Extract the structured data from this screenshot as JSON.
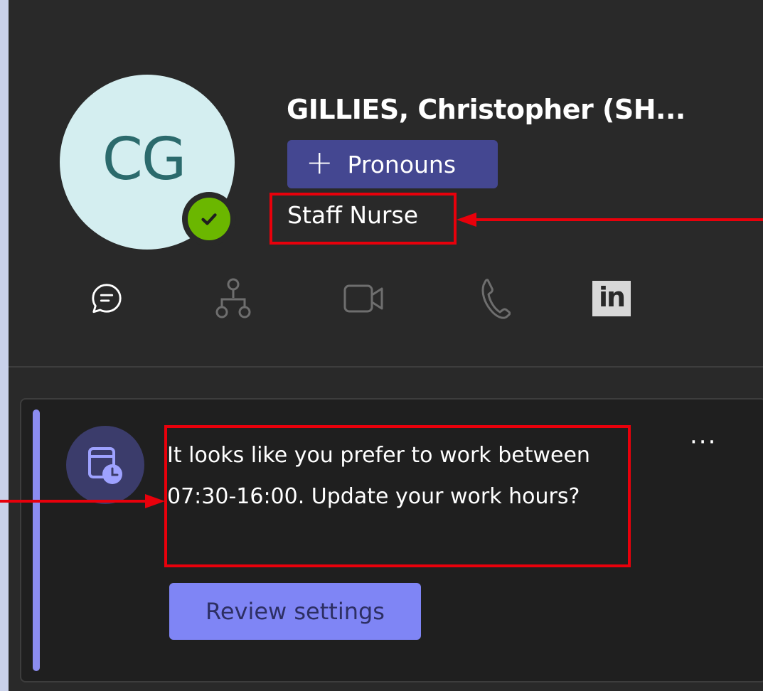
{
  "profile": {
    "initials": "CG",
    "name": "GILLIES, Christopher (SH...",
    "pronouns_label": "Pronouns",
    "job_title": "Staff Nurse",
    "presence": "available"
  },
  "actions": [
    {
      "icon": "chat-icon"
    },
    {
      "icon": "org-chart-icon"
    },
    {
      "icon": "video-call-icon"
    },
    {
      "icon": "phone-icon"
    },
    {
      "icon": "linkedin-icon",
      "label": "in"
    }
  ],
  "card": {
    "icon": "calendar-clock-icon",
    "message": "It looks like you prefer to work between 07:30-16:00. Update your work hours?",
    "more_label": "···",
    "button_label": "Review settings"
  },
  "colors": {
    "panel_bg": "#292929",
    "card_bg": "#1f1f1f",
    "accent": "#8b8cf0",
    "pronouns_bg": "#444791",
    "button_bg": "#7f85f5",
    "presence_green": "#6bb700",
    "annotation_red": "#e8000b",
    "outer_bg": "#c9d1ea"
  }
}
